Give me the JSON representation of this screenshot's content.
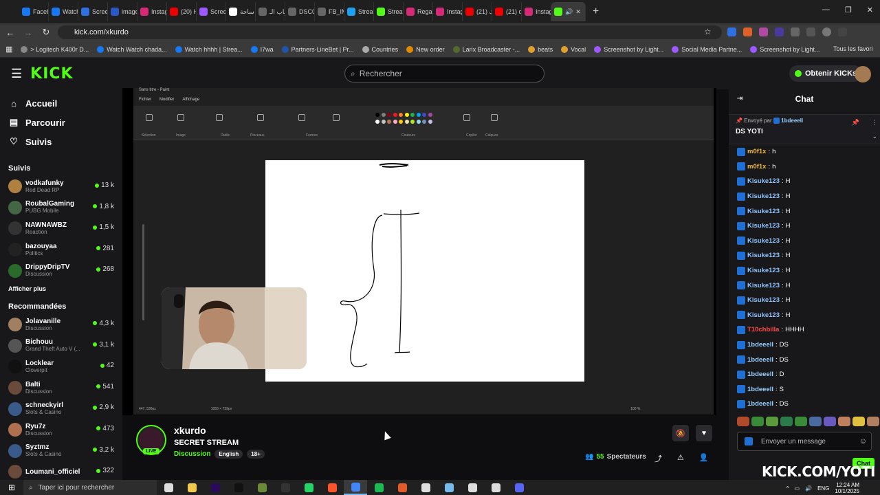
{
  "browser": {
    "tabs": [
      {
        "label": "Faceb",
        "color": "#1877f2"
      },
      {
        "label": "Watch",
        "color": "#1877f2"
      },
      {
        "label": "Screen",
        "color": "#2f6fe0"
      },
      {
        "label": "image",
        "color": "#2b58c7"
      },
      {
        "label": "Instag",
        "color": "#d62976"
      },
      {
        "label": "(20) Ha",
        "color": "#e00"
      },
      {
        "label": "Screen",
        "color": "#9b59ff"
      },
      {
        "label": "ساحة",
        "color": "#ffffff"
      },
      {
        "label": "باب الـ",
        "color": "#666"
      },
      {
        "label": "DSC01",
        "color": "#666"
      },
      {
        "label": "FB_IMG",
        "color": "#666"
      },
      {
        "label": "Stream",
        "color": "#1da1f2"
      },
      {
        "label": "Stream",
        "color": "#53fc18"
      },
      {
        "label": "Regard",
        "color": "#d62976"
      },
      {
        "label": "Instag",
        "color": "#d62976"
      },
      {
        "label": "(21) ك",
        "color": "#e00"
      },
      {
        "label": "(21) di",
        "color": "#e00"
      },
      {
        "label": "Instag",
        "color": "#d62976"
      }
    ],
    "url": "kick.com/xkurdo",
    "bookmarks": [
      {
        "label": "> Logitech K400r D...",
        "color": "#888"
      },
      {
        "label": "Watch Watch chada...",
        "color": "#1877f2"
      },
      {
        "label": "Watch hhhh | Strea...",
        "color": "#1877f2"
      },
      {
        "label": "I7wa",
        "color": "#1877f2"
      },
      {
        "label": "Partners-LineBet | Pr...",
        "color": "#2255aa"
      },
      {
        "label": "Countries",
        "color": "#aaa"
      },
      {
        "label": "New order",
        "color": "#e08a00"
      },
      {
        "label": "Larix Broadcaster -...",
        "color": "#556b2f"
      },
      {
        "label": "beats",
        "color": "#e0a030"
      },
      {
        "label": "Vocal",
        "color": "#e0a030"
      },
      {
        "label": "Screenshot by Light...",
        "color": "#9b59ff"
      },
      {
        "label": "Social Media Partne...",
        "color": "#9b59ff"
      },
      {
        "label": "Screenshot by Light...",
        "color": "#9b59ff"
      }
    ],
    "bookmarks_folder": "Tous les favori"
  },
  "kick": {
    "logo": "KICK",
    "search_placeholder": "Rechercher",
    "get_kicks": "Obtenir KICKs",
    "nav": [
      {
        "label": "Accueil",
        "icon": "home-icon"
      },
      {
        "label": "Parcourir",
        "icon": "browse-icon"
      },
      {
        "label": "Suivis",
        "icon": "heart-icon"
      }
    ],
    "following_title": "Suivis",
    "following": [
      {
        "name": "vodkafunky",
        "category": "Red Dead RP",
        "viewers": "13 k",
        "color": "#b08040"
      },
      {
        "name": "RoubalGaming",
        "category": "PUBG Mobile",
        "viewers": "1,8 k",
        "color": "#446644"
      },
      {
        "name": "NAWNAWBZ",
        "category": "Reaction",
        "viewers": "1,5 k",
        "color": "#333"
      },
      {
        "name": "bazouyaa",
        "category": "Politics",
        "viewers": "281",
        "color": "#222"
      },
      {
        "name": "DrippyDripTV",
        "category": "Discussion",
        "viewers": "268",
        "color": "#2a6a2a"
      }
    ],
    "show_more": "Afficher plus",
    "recommended_title": "Recommandées",
    "recommended": [
      {
        "name": "Jolavanille",
        "category": "Discussion",
        "viewers": "4,3 k",
        "color": "#a08060"
      },
      {
        "name": "Bichouu",
        "category": "Grand Theft Auto V (...",
        "viewers": "3,1 k",
        "color": "#555"
      },
      {
        "name": "Locklear",
        "category": "Cloverpit",
        "viewers": "42",
        "color": "#111"
      },
      {
        "name": "Balti",
        "category": "Discussion",
        "viewers": "541",
        "color": "#6a4a3a"
      },
      {
        "name": "schneckyirl",
        "category": "Slots & Casino",
        "viewers": "2,9 k",
        "color": "#3a5a8a"
      },
      {
        "name": "Ryu7z",
        "category": "Discussion",
        "viewers": "473",
        "color": "#b07050"
      },
      {
        "name": "Syztmz",
        "category": "Slots & Casino",
        "viewers": "3,2 k",
        "color": "#3a5a8a"
      },
      {
        "name": "Loumani_officiel",
        "category": "",
        "viewers": "322",
        "color": "#6a4a3a"
      }
    ]
  },
  "paint": {
    "window_title": "Sans titre - Paint",
    "menu": [
      "Fichier",
      "Modifier",
      "Affichage"
    ],
    "ribbon_labels": [
      "Sélection",
      "Image",
      "Outils",
      "Pinceaux",
      "Formes",
      "Couleurs",
      "Copilot",
      "Calques"
    ],
    "palette": [
      "#000000",
      "#7f7f7f",
      "#880015",
      "#ed1c24",
      "#ff7f27",
      "#fff200",
      "#22b14c",
      "#00a2e8",
      "#3f48cc",
      "#a349a4",
      "#ffffff",
      "#c3c3c3",
      "#b97a57",
      "#ffaec9",
      "#ffc90e",
      "#efe4b0",
      "#b5e61d",
      "#99d9ea",
      "#7092be",
      "#c8bfe7"
    ],
    "status_position": "447, 530px",
    "status_size": "1055 × 739px",
    "zoom": "100 %"
  },
  "stream": {
    "streamer": "xkurdo",
    "title": "SECRET STREAM",
    "live_label": "LIVE",
    "category": "Discussion",
    "tags": [
      "English",
      "18+"
    ],
    "viewers": "55",
    "viewers_label": "Spectateurs"
  },
  "chat": {
    "title": "Chat",
    "pinned_by_prefix": "Envoyé par",
    "pinned_by": "1bdeeell",
    "pinned_message": "DS YOTI",
    "messages": [
      {
        "user": "m0f1x",
        "text": "h",
        "color": "#f0b83a"
      },
      {
        "user": "m0f1x",
        "text": "h",
        "color": "#f0b83a"
      },
      {
        "user": "Kisuke123",
        "text": "H",
        "color": "#8fc3ff"
      },
      {
        "user": "Kisuke123",
        "text": "H",
        "color": "#8fc3ff"
      },
      {
        "user": "Kisuke123",
        "text": "H",
        "color": "#8fc3ff"
      },
      {
        "user": "Kisuke123",
        "text": "H",
        "color": "#8fc3ff"
      },
      {
        "user": "Kisuke123",
        "text": "H",
        "color": "#8fc3ff"
      },
      {
        "user": "Kisuke123",
        "text": "H",
        "color": "#8fc3ff"
      },
      {
        "user": "Kisuke123",
        "text": "H",
        "color": "#8fc3ff"
      },
      {
        "user": "Kisuke123",
        "text": "H",
        "color": "#8fc3ff"
      },
      {
        "user": "Kisuke123",
        "text": "H",
        "color": "#8fc3ff"
      },
      {
        "user": "Kisuke123",
        "text": "H",
        "color": "#8fc3ff"
      },
      {
        "user": "T10chbilla",
        "text": "HHHH",
        "color": "#ff4d4d"
      },
      {
        "user": "1bdeeell",
        "text": "DS",
        "color": "#9ad0ff"
      },
      {
        "user": "1bdeeell",
        "text": "DS",
        "color": "#9ad0ff"
      },
      {
        "user": "1bdeeell",
        "text": "D",
        "color": "#9ad0ff"
      },
      {
        "user": "1bdeeell",
        "text": "S",
        "color": "#9ad0ff"
      },
      {
        "user": "1bdeeell",
        "text": "DS",
        "color": "#9ad0ff"
      }
    ],
    "input_placeholder": "Envoyer un message",
    "send_label": "Chat"
  },
  "watermark": "KICK.COM/YOTI",
  "taskbar": {
    "search_placeholder": "Taper ici pour rechercher",
    "apps": [
      {
        "name": "task-view-icon",
        "color": "#ddd"
      },
      {
        "name": "file-explorer-icon",
        "color": "#f2c94c"
      },
      {
        "name": "premiere-icon",
        "color": "#2a0a5a"
      },
      {
        "name": "tiktok-icon",
        "color": "#111"
      },
      {
        "name": "minecraft-icon",
        "color": "#6a8a3a"
      },
      {
        "name": "epic-games-icon",
        "color": "#333"
      },
      {
        "name": "whatsapp-icon",
        "color": "#25d366"
      },
      {
        "name": "brave-icon",
        "color": "#fb542b"
      },
      {
        "name": "chrome-icon",
        "color": "#4285f4"
      },
      {
        "name": "spotify-icon",
        "color": "#1db954"
      },
      {
        "name": "mic-icon",
        "color": "#e05a2a"
      },
      {
        "name": "steelseries-icon",
        "color": "#ddd"
      },
      {
        "name": "notepad-icon",
        "color": "#76b9ed"
      },
      {
        "name": "media-player-icon",
        "color": "#ddd"
      },
      {
        "name": "obs-icon",
        "color": "#ddd"
      },
      {
        "name": "discord-icon",
        "color": "#5865f2"
      }
    ],
    "lang": "ENG",
    "time": "12:24 AM",
    "date": "10/1/2025"
  }
}
